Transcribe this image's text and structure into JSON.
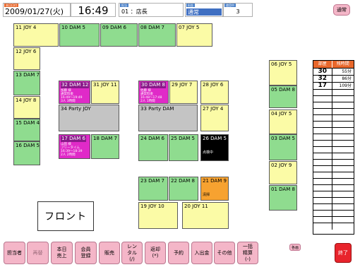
{
  "header": {
    "date_label": "本日日付",
    "date": "2009/01/27(火)",
    "time": "16:49",
    "staff_label": "担当",
    "staff": "01 ：店長",
    "fee_label": "料金",
    "fee": "通常",
    "tax_label": "使用中",
    "tax": "3",
    "mode_button": "通常"
  },
  "rooms": [
    {
      "key": "r11",
      "label": "11 JOY 4",
      "color": "yellow"
    },
    {
      "key": "r10",
      "label": "10 DAM 5",
      "color": "green"
    },
    {
      "key": "r09",
      "label": "09 DAM 6",
      "color": "green"
    },
    {
      "key": "r08",
      "label": "08 DAM 7",
      "color": "green"
    },
    {
      "key": "r07",
      "label": "07 JOY 5",
      "color": "yellow"
    },
    {
      "key": "r12",
      "label": "12 JOY 6",
      "color": "yellow"
    },
    {
      "key": "r13",
      "label": "13 DAM 7",
      "color": "green"
    },
    {
      "key": "r14",
      "label": "14 JOY 8",
      "color": "yellow"
    },
    {
      "key": "r15",
      "label": "15 DAM 4",
      "color": "green"
    },
    {
      "key": "r16",
      "label": "16 DAM 5",
      "color": "green"
    },
    {
      "key": "r32",
      "label": "32 DAM 12",
      "color": "magenta",
      "detail": "加藤 様\n通常料金\n16:49～19:49\n3人 3時間"
    },
    {
      "key": "r31",
      "label": "31 JOY 11",
      "color": "yellow"
    },
    {
      "key": "r30",
      "label": "30 DAM 8",
      "color": "magenta",
      "detail": "佐藤 様\n通常料金\n16:48～17:48\n2人 1時間"
    },
    {
      "key": "r29",
      "label": "29 JOY 7",
      "color": "yellow"
    },
    {
      "key": "r28",
      "label": "28 JOY 6",
      "color": "yellow"
    },
    {
      "key": "r34",
      "label": "34 Party JOY",
      "color": "gray"
    },
    {
      "key": "r33",
      "label": "33 Party DAM",
      "color": "gray"
    },
    {
      "key": "r27",
      "label": "27 JOY 4",
      "color": "yellow"
    },
    {
      "key": "r17",
      "label": "17 DAM 6",
      "color": "magenta",
      "detail": "山田 様\nフリータイム\n16:39～18:39\n2人 2時間"
    },
    {
      "key": "r18",
      "label": "18 DAM 7",
      "color": "green"
    },
    {
      "key": "r24",
      "label": "24 DAM 6",
      "color": "green"
    },
    {
      "key": "r25",
      "label": "25 DAM 5",
      "color": "green"
    },
    {
      "key": "r26",
      "label": "26 DAM 5",
      "color": "black",
      "status": "点検中"
    },
    {
      "key": "r23",
      "label": "23 DAM 7",
      "color": "green"
    },
    {
      "key": "r22",
      "label": "22 DAM 8",
      "color": "green"
    },
    {
      "key": "r21",
      "label": "21 DAM 9",
      "color": "orange",
      "status": "清掃"
    },
    {
      "key": "r19",
      "label": "19 JOY 10",
      "color": "yellow"
    },
    {
      "key": "r20",
      "label": "20 JOY 11",
      "color": "yellow"
    },
    {
      "key": "r06",
      "label": "06 JOY 5",
      "color": "yellow"
    },
    {
      "key": "r05",
      "label": "05 DAM 8",
      "color": "green"
    },
    {
      "key": "r04",
      "label": "04 JOY 5",
      "color": "yellow"
    },
    {
      "key": "r03",
      "label": "03 DAM 5",
      "color": "green"
    },
    {
      "key": "r02",
      "label": "02 JOY 9",
      "color": "yellow"
    },
    {
      "key": "r01",
      "label": "01 DAM 8",
      "color": "green"
    }
  ],
  "side_panel": {
    "col_room": "部屋",
    "col_time": "残時間",
    "rows": [
      {
        "room": "30",
        "remaining": "55分"
      },
      {
        "room": "32",
        "remaining": "86分"
      },
      {
        "room": "17",
        "remaining": "109分"
      }
    ]
  },
  "front_label": "フロント",
  "bottom_buttons": [
    {
      "key": "staff",
      "label": "担当者"
    },
    {
      "key": "reprint",
      "label": "再替",
      "disabled": true
    },
    {
      "key": "sales",
      "label": "本日\n売上"
    },
    {
      "key": "member",
      "label": "会員\n登録"
    },
    {
      "key": "shop",
      "label": "販売"
    },
    {
      "key": "rental",
      "label": "レン\nタル\n(/)"
    },
    {
      "key": "return",
      "label": "返却\n(*)"
    },
    {
      "key": "reserve",
      "label": "予約"
    },
    {
      "key": "cash",
      "label": "入出金"
    },
    {
      "key": "other",
      "label": "その他"
    },
    {
      "key": "bulk",
      "label": "一括\n精算\n(-)"
    }
  ],
  "small_label": "各画",
  "exit_button": "終了",
  "colors": {
    "green": "#8fdc8f",
    "yellow": "#fbfba6",
    "magenta": "#e02ac8",
    "gray": "#c4c4c4",
    "orange": "#f7a230",
    "black": "#000000",
    "button_pink": "#f4b6c8",
    "exit_red": "#e8242c",
    "panel_header": "#e8672b"
  }
}
